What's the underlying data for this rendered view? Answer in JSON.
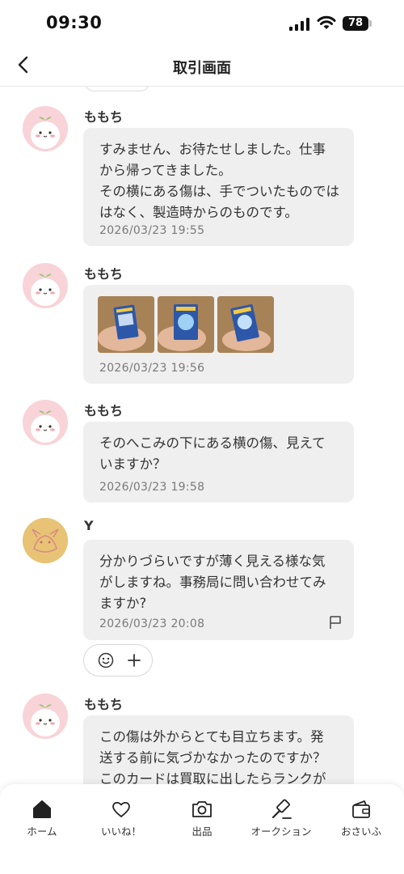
{
  "status_bar": {
    "time": "09:30",
    "battery": "78"
  },
  "header": {
    "title": "取引画面"
  },
  "messages": [
    {
      "sender": "ももち",
      "text_lines": [
        "すみません、お待たせしました。仕事",
        "から帰ってきました。",
        "その横にある傷は、手でついたものでは",
        "はなく、製造時からのものです。"
      ],
      "timestamp": "2026/03/23 19:55"
    },
    {
      "sender": "ももち",
      "images": [
        "card-photo-1",
        "card-photo-2",
        "card-photo-3"
      ],
      "timestamp": "2026/03/23 19:56"
    },
    {
      "sender": "ももち",
      "text_lines": [
        "そのへこみの下にある横の傷、見えて",
        "いますか？"
      ],
      "timestamp": "2026/03/23 19:58"
    },
    {
      "sender": "Y",
      "text_lines": [
        "分かりづらいですが薄く見える様な気",
        "がしますね。事務局に問い合わせてみ",
        "ますか?"
      ],
      "timestamp": "2026/03/23 20:08"
    },
    {
      "sender": "ももち",
      "text_lines": [
        "この傷は外からとても目立ちます。発",
        "送する前に気づかなかったのですか？",
        "このカードは買取に出したらランクが"
      ]
    }
  ],
  "bottom_nav": {
    "items": [
      {
        "label": "ホーム",
        "icon": "home-icon"
      },
      {
        "label": "いいね！",
        "icon": "heart-icon"
      },
      {
        "label": "出品",
        "icon": "camera-icon"
      },
      {
        "label": "オークション",
        "icon": "gavel-icon"
      },
      {
        "label": "おさいふ",
        "icon": "wallet-icon"
      }
    ]
  },
  "colors": {
    "bubble": "#efefef",
    "mochi_avatar": "#f8d3d8",
    "y_avatar": "#e8c376",
    "timestamp": "#7a7a7a"
  }
}
